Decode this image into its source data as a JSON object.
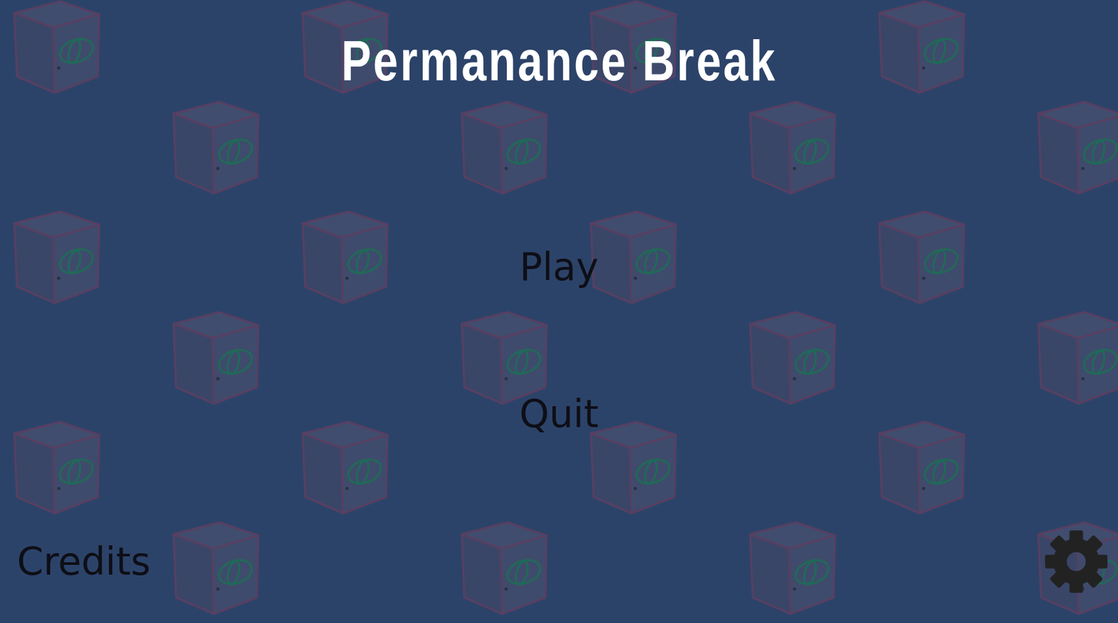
{
  "title": "Permanance Break",
  "menu": [
    {
      "label": "Play"
    },
    {
      "label": "Quit"
    }
  ],
  "footer": {
    "credits": "Credits"
  }
}
